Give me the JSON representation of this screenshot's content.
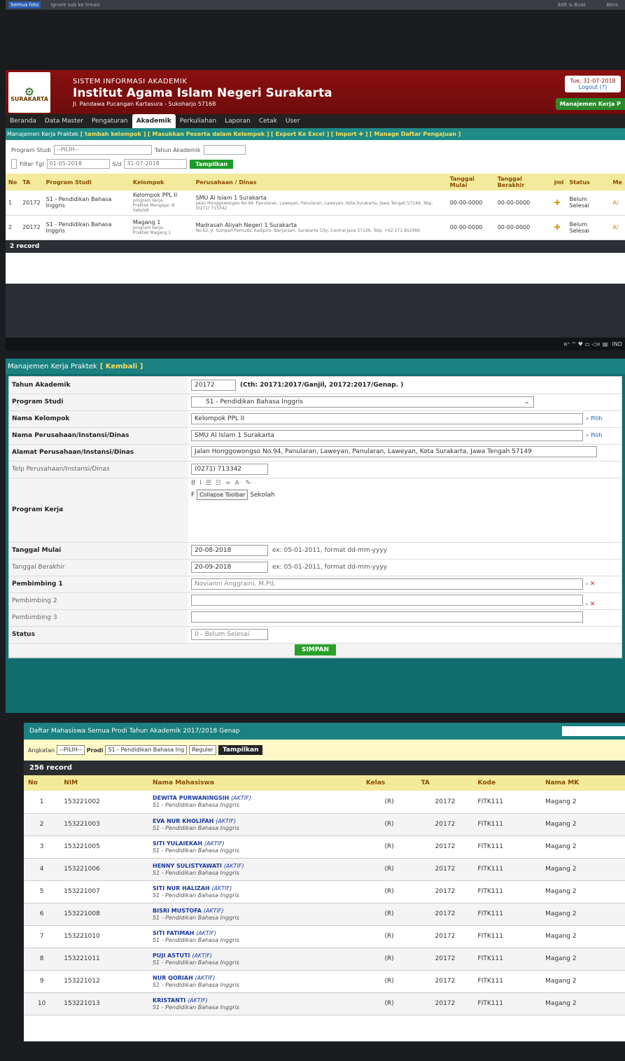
{
  "shot1": {
    "os_top": {
      "left_label": "Semua foto",
      "left_text": "Ignore sub ke kreasi",
      "right_edit": "Edit & Buat",
      "right_share": "Bera"
    },
    "header": {
      "logo_text": "SURAKARTA",
      "system_name": "SISTEM INFORMASI AKADEMIK",
      "institution": "Institut Agama Islam Negeri Surakarta",
      "address": "Jl. Pandawa Pucangan Kartasura - Sukoharjo 57168",
      "date": "Tue, 31-07-2018",
      "logout": "Logout (?)",
      "module_button": "Manajemen Kerja P"
    },
    "nav": [
      "Beranda",
      "Data Master",
      "Pengaturan",
      "Akademik",
      "Perkuliahan",
      "Laporan",
      "Cetak",
      "User"
    ],
    "nav_active": "Akademik",
    "subnav": {
      "title": "Manajemen Kerja Praktek",
      "links": [
        "[ tambah kelompok ]",
        "[ Masukkan Peserta dalam Kelompok ]",
        "[ Export Ke Excel ]",
        "[ Import ✚ ]",
        "[ Manage Daftar Pengajuan ]"
      ]
    },
    "filter": {
      "program_label": "Program Studi",
      "program_value": "--PILIH--",
      "tahun_label": "Tahun Akademik",
      "tahun_value": "",
      "tgl_label": "Filter Tgl",
      "tgl_from": "01-05-2018",
      "sd_label": "S/d",
      "tgl_to": "31-07-2018",
      "button": "Tampilkan"
    },
    "table": {
      "headers": [
        "No",
        "TA",
        "Program Studi",
        "Kelompok",
        "Perusahaan / Dinas",
        "Tanggal Mulai",
        "Tanggal Berakhir",
        "jml",
        "Status",
        "Me"
      ],
      "rows": [
        {
          "no": "1",
          "ta": "20172",
          "prodi": "S1 - Pendidikan Bahasa Inggris",
          "kelompok": "Kelompok PPL II",
          "kelompok_sub1": "program kerja:",
          "kelompok_sub2": "Praktek Mengajar di Sekolah",
          "perusahaan": "SMU Al Islam 1 Surakarta",
          "alamat": "Jalan Honggowongso No.94, Panularan, Laweyan, Panularan, Laweyan, Kota Surakarta, Jawa Tengah 57149, Telp: (0271) 713342",
          "mulai": "00-00-0000",
          "akhir": "00-00-0000",
          "jml": "✚",
          "status": "Belum Selesai",
          "aksi": "A/"
        },
        {
          "no": "2",
          "ta": "20172",
          "prodi": "S1 - Pendidikan Bahasa Inggris",
          "kelompok": "Magang 1",
          "kelompok_sub1": "program kerja:",
          "kelompok_sub2": "Praktek Magang 1",
          "perusahaan": "Madrasah Aliyah Negeri 1 Surakarta",
          "alamat": "No.62, Jl. Sumpah Pemuda, Kadipiro, Banjarsari, Surakarta City, Central Java 57136, Telp: +62 271 852066",
          "mulai": "00-00-0000",
          "akhir": "00-00-0000",
          "jml": "✚",
          "status": "Belum Selesai",
          "aksi": "A/"
        }
      ],
      "footer": "2 record"
    },
    "taskbar": {
      "tray": "ʀᴬ ^ ♥ ▭ ◁× ▤",
      "lang": "IND"
    }
  },
  "shot2": {
    "title": "Manajemen Kerja Praktek",
    "back": "[ Kembali ]",
    "fields": {
      "tahun": {
        "label": "Tahun Akademik",
        "value": "20172",
        "hint": "(Cth: 20171:2017/Ganjil, 20172:2017/Genap. )"
      },
      "prodi": {
        "label": "Program Studi",
        "value": "S1 - Pendidikan Bahasa Inggris"
      },
      "kelompok": {
        "label": "Nama Kelompok",
        "value": "Kelompok PPL II",
        "pilih": "Pilih"
      },
      "perusahaan": {
        "label": "Nama Perusahaan/Instansi/Dinas",
        "value": "SMU Al Islam 1 Surakarta",
        "pilih": "Pilih"
      },
      "alamat": {
        "label": "Alamat Perusahaan/Instansi/Dinas",
        "value": "Jalan Honggowongso No.94, Panularan, Laweyan, Panularan, Laweyan, Kota Surakarta, Jawa Tengah 57149"
      },
      "telp": {
        "label": "Telp Perusahaan/Instansi/Dinas",
        "value": "(0271) 713342"
      },
      "program": {
        "label": "Program Kerja",
        "tooltip": "Collapse Toolbar",
        "value_prefix": "F",
        "value": "Sekolah",
        "toolbar": [
          "B",
          "I",
          "☰",
          "☷",
          "∞",
          "A·",
          "✎·"
        ]
      },
      "mulai": {
        "label": "Tanggal Mulai",
        "value": "20-08-2018",
        "hint": "ex: 05-01-2011, format dd-mm-yyyy"
      },
      "akhir": {
        "label": "Tanggal Berakhir",
        "value": "20-09-2018",
        "hint": "ex: 05-01-2011, format dd-mm-yyyy"
      },
      "pemb1": {
        "label": "Pembimbing 1",
        "value": "Novianni Anggraini, M.Pd."
      },
      "pemb2": {
        "label": "Pembimbing 2",
        "value": ""
      },
      "pemb3": {
        "label": "Pembimbing 3",
        "value": ""
      },
      "status": {
        "label": "Status",
        "value": "0 - Belum Selesai"
      }
    },
    "save": "SIMPAN"
  },
  "shot3": {
    "title": "Daftar Mahasiswa Semua Prodi Tahun Akademik 2017/2018 Genap",
    "filter": {
      "angkatan_label": "Angkatan",
      "angkatan_value": "--PILIH--",
      "prodi_label": "Prodi",
      "prodi_value": "S1 - Pendidikan Bahasa Ing",
      "kelas_value": "Reguler",
      "button": "Tampilkan"
    },
    "record": "256 record",
    "headers": [
      "No",
      "NIM",
      "Nama Mahasiswa",
      "Kelas",
      "TA",
      "Kode",
      "Nama MK"
    ],
    "rows": [
      {
        "no": "1",
        "nim": "153221002",
        "nama": "DEWITA PURWANINGSIH",
        "st": "(AKTIF)",
        "prodi": "S1 - Pendidikan Bahasa Inggris",
        "kelas": "(R)",
        "ta": "20172",
        "kode": "FITK111",
        "mk": "Magang 2"
      },
      {
        "no": "2",
        "nim": "153221003",
        "nama": "EVA NUR KHOLIFAH",
        "st": "(AKTIF)",
        "prodi": "S1 - Pendidikan Bahasa Inggris",
        "kelas": "(R)",
        "ta": "20172",
        "kode": "FITK111",
        "mk": "Magang 2"
      },
      {
        "no": "3",
        "nim": "153221005",
        "nama": "SITI YULAIEKAH",
        "st": "(AKTIF)",
        "prodi": "S1 - Pendidikan Bahasa Inggris",
        "kelas": "(R)",
        "ta": "20172",
        "kode": "FITK111",
        "mk": "Magang 2"
      },
      {
        "no": "4",
        "nim": "153221006",
        "nama": "HENNY SULISTYAWATI",
        "st": "(AKTIF)",
        "prodi": "S1 - Pendidikan Bahasa Inggris",
        "kelas": "(R)",
        "ta": "20172",
        "kode": "FITK111",
        "mk": "Magang 2"
      },
      {
        "no": "5",
        "nim": "153221007",
        "nama": "SITI NUR HALIZAH",
        "st": "(AKTIF)",
        "prodi": "S1 - Pendidikan Bahasa Inggris",
        "kelas": "(R)",
        "ta": "20172",
        "kode": "FITK111",
        "mk": "Magang 2"
      },
      {
        "no": "6",
        "nim": "153221008",
        "nama": "BISRI MUSTOFA",
        "st": "(AKTIF)",
        "prodi": "S1 - Pendidikan Bahasa Inggris",
        "kelas": "(R)",
        "ta": "20172",
        "kode": "FITK111",
        "mk": "Magang 2"
      },
      {
        "no": "7",
        "nim": "153221010",
        "nama": "SITI FATIMAH",
        "st": "(AKTIF)",
        "prodi": "S1 - Pendidikan Bahasa Inggris",
        "kelas": "(R)",
        "ta": "20172",
        "kode": "FITK111",
        "mk": "Magang 2"
      },
      {
        "no": "8",
        "nim": "153221011",
        "nama": "PUJI ASTUTI",
        "st": "(AKTIF)",
        "prodi": "S1 - Pendidikan Bahasa Inggris",
        "kelas": "(R)",
        "ta": "20172",
        "kode": "FITK111",
        "mk": "Magang 2"
      },
      {
        "no": "9",
        "nim": "153221012",
        "nama": "NUR QORIAH",
        "st": "(AKTIF)",
        "prodi": "S1 - Pendidikan Bahasa Inggris",
        "kelas": "(R)",
        "ta": "20172",
        "kode": "FITK111",
        "mk": "Magang 2"
      },
      {
        "no": "10",
        "nim": "153221013",
        "nama": "KRISTANTI",
        "st": "(AKTIF)",
        "prodi": "S1 - Pendidikan Bahasa Inggris",
        "kelas": "(R)",
        "ta": "20172",
        "kode": "FITK111",
        "mk": "Magang 2"
      }
    ]
  },
  "icons": {
    "search": "search-icon",
    "plus": "plus-icon",
    "remove": "remove-icon",
    "dropdown": "chevron-down-icon"
  }
}
